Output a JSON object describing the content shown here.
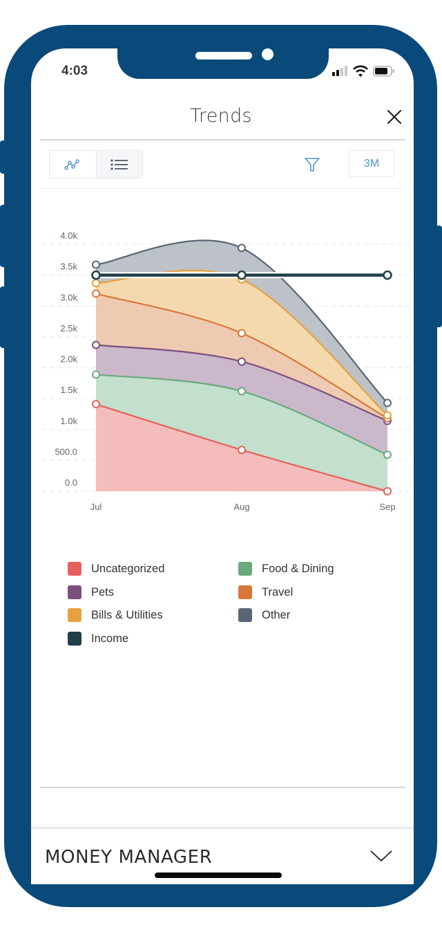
{
  "status_bar": {
    "time": "4:03",
    "signal_icon": "cellular-signal-icon",
    "wifi_icon": "wifi-icon",
    "battery_icon": "battery-icon"
  },
  "header": {
    "title": "Trends",
    "close_icon": "close-icon"
  },
  "toolbar": {
    "view_toggle": [
      {
        "name": "chart-view",
        "icon": "line-chart-icon",
        "active": true
      },
      {
        "name": "list-view",
        "icon": "list-icon",
        "active": false
      }
    ],
    "filter_icon": "filter-icon",
    "range_label": "3M"
  },
  "colors": {
    "frame": "#0a4a7a",
    "accent": "#4a95cf"
  },
  "chart_data": {
    "type": "area",
    "stacked": true,
    "title": "",
    "xlabel": "",
    "ylabel": "",
    "categories": [
      "Jul",
      "Aug",
      "Sep"
    ],
    "y_ticks": [
      "0.0",
      "500.0",
      "1.0k",
      "1.5k",
      "2.0k",
      "2.5k",
      "3.0k",
      "3.5k",
      "4.0k"
    ],
    "ylim": [
      0,
      4000
    ],
    "grid": true,
    "series": [
      {
        "name": "Uncategorized",
        "color": "#e5605a",
        "fill": "#f4bcbb",
        "cumulative": [
          1410,
          670,
          0
        ]
      },
      {
        "name": "Food & Dining",
        "color": "#69a97c",
        "fill": "#c3dfcd",
        "cumulative": [
          1890,
          1620,
          590
        ]
      },
      {
        "name": "Pets",
        "color": "#7b4f7e",
        "fill": "#cbb8cb",
        "cumulative": [
          2370,
          2100,
          1140
        ]
      },
      {
        "name": "Travel",
        "color": "#d9773b",
        "fill": "#edcab1",
        "cumulative": [
          3200,
          2560,
          1180
        ]
      },
      {
        "name": "Bills & Utilities",
        "color": "#e7a040",
        "fill": "#f5d9ae",
        "cumulative": [
          3370,
          3430,
          1230
        ]
      },
      {
        "name": "Other",
        "color": "#5a6675",
        "fill": "#bcc2c8",
        "cumulative": [
          3670,
          3940,
          1430
        ]
      }
    ],
    "line_series": [
      {
        "name": "Income",
        "color": "#213f4a",
        "values": [
          3500,
          3500,
          3500
        ]
      }
    ],
    "legend_position": "bottom"
  },
  "legend": [
    {
      "label": "Uncategorized",
      "color": "#e5605a"
    },
    {
      "label": "Food & Dining",
      "color": "#69a97c"
    },
    {
      "label": "Pets",
      "color": "#7b4f7e"
    },
    {
      "label": "Travel",
      "color": "#d9773b"
    },
    {
      "label": "Bills & Utilities",
      "color": "#e7a040"
    },
    {
      "label": "Other",
      "color": "#5a6675"
    },
    {
      "label": "Income",
      "color": "#213f4a"
    }
  ],
  "bottom_bar": {
    "label": "MONEY MANAGER",
    "chevron_icon": "chevron-down-icon"
  }
}
